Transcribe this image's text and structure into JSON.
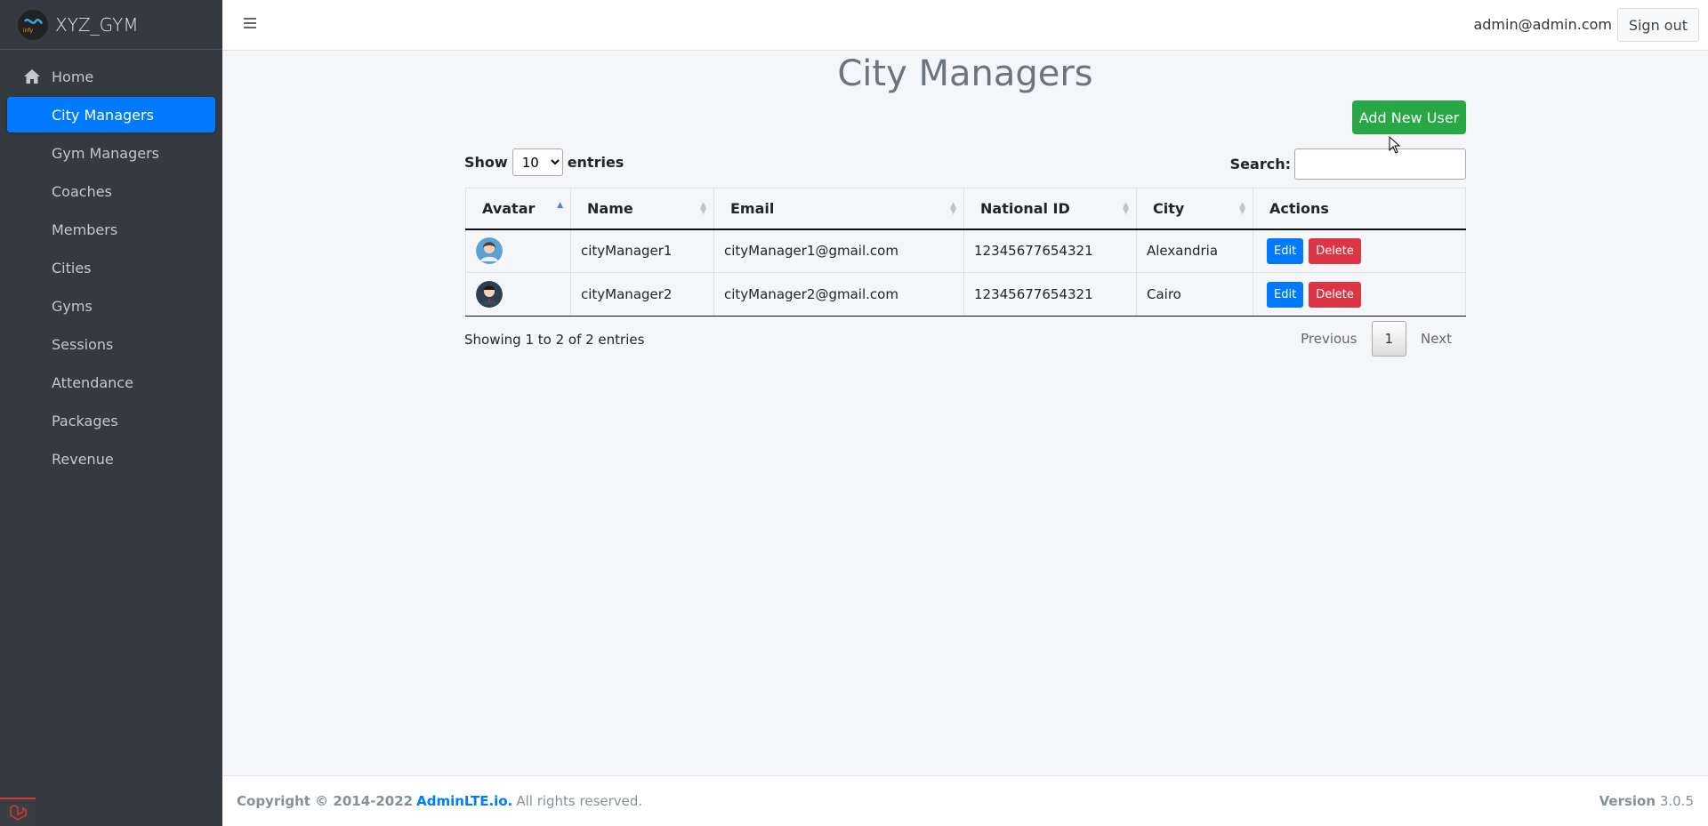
{
  "brand": {
    "name": "XYZ_GYM"
  },
  "sidebar": {
    "items": [
      {
        "label": "Home",
        "icon": "home-icon",
        "active": false
      },
      {
        "label": "City Managers",
        "active": true
      },
      {
        "label": "Gym Managers",
        "active": false
      },
      {
        "label": "Coaches",
        "active": false
      },
      {
        "label": "Members",
        "active": false
      },
      {
        "label": "Cities",
        "active": false
      },
      {
        "label": "Gyms",
        "active": false
      },
      {
        "label": "Sessions",
        "active": false
      },
      {
        "label": "Attendance",
        "active": false
      },
      {
        "label": "Packages",
        "active": false
      },
      {
        "label": "Revenue",
        "active": false
      }
    ]
  },
  "header": {
    "user_email": "admin@admin.com",
    "signout_label": "Sign out"
  },
  "page": {
    "title": "City Managers",
    "add_button_label": "Add New User"
  },
  "table_controls": {
    "show_label": "Show",
    "entries_value": "10",
    "entries_label": "entries",
    "search_label": "Search:"
  },
  "table": {
    "columns": [
      "Avatar",
      "Name",
      "Email",
      "National ID",
      "City",
      "Actions"
    ],
    "rows": [
      {
        "name": "cityManager1",
        "email": "cityManager1@gmail.com",
        "national_id": "12345677654321",
        "city": "Alexandria",
        "edit": "Edit",
        "delete": "Delete"
      },
      {
        "name": "cityManager2",
        "email": "cityManager2@gmail.com",
        "national_id": "12345677654321",
        "city": "Cairo",
        "edit": "Edit",
        "delete": "Delete"
      }
    ]
  },
  "pagination": {
    "info": "Showing 1 to 2 of 2 entries",
    "previous": "Previous",
    "current": "1",
    "next": "Next"
  },
  "footer": {
    "copyright": "Copyright © 2014-2022",
    "link": "AdminLTE.io.",
    "rights": "All rights reserved.",
    "version_label": "Version",
    "version": "3.0.5"
  },
  "colors": {
    "primary": "#007bff",
    "success": "#28a745",
    "danger": "#dc3545",
    "sidebar": "#343a40"
  }
}
